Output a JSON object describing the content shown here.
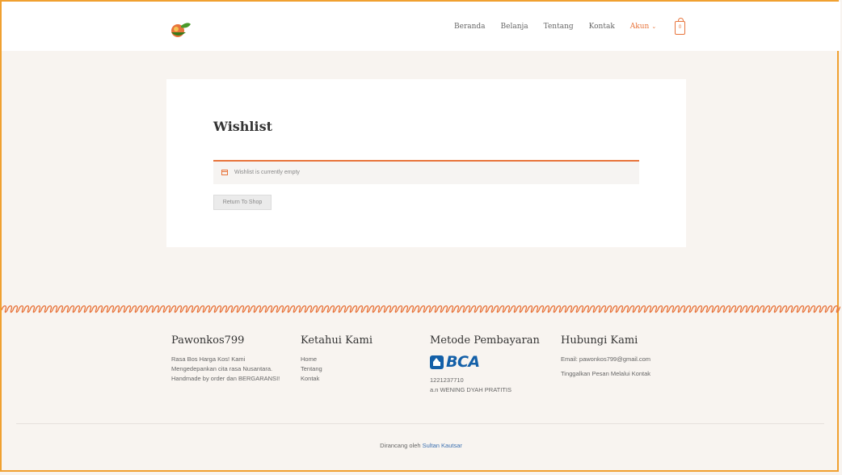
{
  "header": {
    "nav": [
      {
        "label": "Beranda"
      },
      {
        "label": "Belanja"
      },
      {
        "label": "Tentang"
      },
      {
        "label": "Kontak"
      },
      {
        "label": "Akun"
      }
    ],
    "cart_count": "0"
  },
  "main": {
    "title": "Wishlist",
    "notice": "Wishlist is currently empty",
    "return_button": "Return To Shop"
  },
  "footer": {
    "col1": {
      "title": "Pawonkos799",
      "text": "Rasa Bos Harga Kos! Kami Mengedepankan cita rasa Nusantara. Handmade by order dan BERGARANSI!"
    },
    "col2": {
      "title": "Ketahui Kami",
      "links": [
        "Home",
        "Tentang",
        "Kontak"
      ]
    },
    "col3": {
      "title": "Metode Pembayaran",
      "bank": "BCA",
      "account_number": "1221237710",
      "account_name": "a.n WENING DYAH PRATITIS"
    },
    "col4": {
      "title": "Hubungi Kami",
      "email": "Email: pawonkos799@gmail.com",
      "contact": "Tinggalkan Pesan Melalui Kontak"
    },
    "credit_prefix": "Dirancang oleh",
    "credit_author": "Sultan Kautsar"
  },
  "colors": {
    "accent": "#e8743b",
    "border": "#f0a030",
    "bca_blue": "#1460a8"
  }
}
